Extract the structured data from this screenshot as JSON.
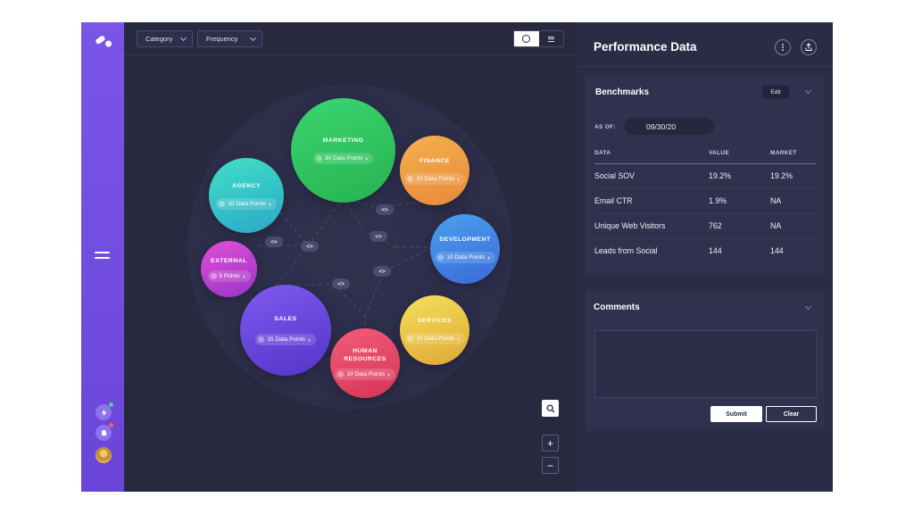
{
  "toolbar": {
    "category_label": "Category",
    "frequency_label": "Frequency",
    "view_circle_icon": "circle-view-icon",
    "view_list_icon": "list-view-icon"
  },
  "graph": {
    "nodes": [
      {
        "id": "marketing",
        "title": "MARKETING",
        "points": "30 Data Points",
        "color_from": "#3ad56f",
        "color_to": "#27b352"
      },
      {
        "id": "finance",
        "title": "FINANCE",
        "points": "10 Data Points",
        "color_from": "#f5b04f",
        "color_to": "#e8893a"
      },
      {
        "id": "agency",
        "title": "AGENCY",
        "points": "10 Data Points",
        "color_from": "#3fe0c6",
        "color_to": "#2ca7c9"
      },
      {
        "id": "development",
        "title": "DEVELOPMENT",
        "points": "10 Data Points",
        "color_from": "#4aa0ee",
        "color_to": "#3a6ad6"
      },
      {
        "id": "external",
        "title": "EXTERNAL",
        "points": "5 Points",
        "color_from": "#e04fd6",
        "color_to": "#9a35c6"
      },
      {
        "id": "sales",
        "title": "SALES",
        "points": "15 Data Points",
        "color_from": "#7f5af0",
        "color_to": "#5534c8"
      },
      {
        "id": "services",
        "title": "SERVICES",
        "points": "10 Data Points",
        "color_from": "#f4e05a",
        "color_to": "#e0a735"
      },
      {
        "id": "hr",
        "title": "HUMAN\nRESOURCES",
        "points": "10 Data Points",
        "color_from": "#f25d7a",
        "color_to": "#d63456"
      }
    ],
    "link_glyph": "<>",
    "chevron_glyph": "›",
    "zoom_in": "+",
    "zoom_out": "−"
  },
  "panel": {
    "title": "Performance Data",
    "benchmarks": {
      "title": "Benchmarks",
      "edit_label": "Edit",
      "as_of_label": "AS OF:",
      "as_of_value": "09/30/20",
      "columns": [
        "DATA",
        "VALUE",
        "MARKET"
      ],
      "rows": [
        [
          "Social SOV",
          "19.2%",
          "19.2%"
        ],
        [
          "Email CTR",
          "1.9%",
          "NA"
        ],
        [
          "Unique Web Visitors",
          "762",
          "NA"
        ],
        [
          "Leads from Social",
          "144",
          "144"
        ]
      ]
    },
    "comments": {
      "title": "Comments",
      "placeholder": "",
      "submit_label": "Submit",
      "clear_label": "Clear"
    }
  },
  "colors": {
    "rail": "#7b55e8",
    "background": "#2a2b45",
    "notification_green": "#3ddc84",
    "notification_red": "#ff5a6e"
  }
}
